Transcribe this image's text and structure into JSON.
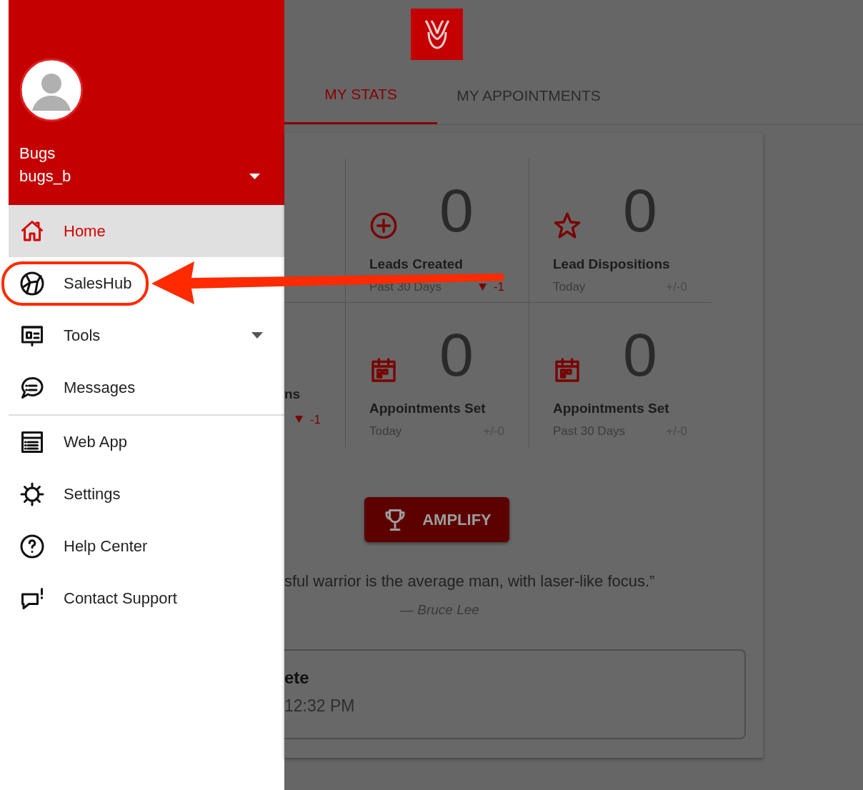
{
  "drawer": {
    "user": {
      "name": "Bugs",
      "username": "bugs_b"
    },
    "items": [
      {
        "label": "Home",
        "selected": true,
        "has_submenu": false
      },
      {
        "label": "SalesHub",
        "selected": false,
        "has_submenu": false
      },
      {
        "label": "Tools",
        "selected": false,
        "has_submenu": true
      },
      {
        "label": "Messages",
        "selected": false,
        "has_submenu": false
      }
    ],
    "secondary_items": [
      {
        "label": "Web App",
        "selected": false,
        "has_submenu": false
      },
      {
        "label": "Settings",
        "selected": false,
        "has_submenu": false
      },
      {
        "label": "Help Center",
        "selected": false,
        "has_submenu": false
      },
      {
        "label": "Contact Support",
        "selected": false,
        "has_submenu": false
      }
    ]
  },
  "tabs": [
    {
      "label": "MY STATS",
      "selected": true
    },
    {
      "label": "MY APPOINTMENTS",
      "selected": false
    }
  ],
  "stats": [
    {
      "kind": "empty"
    },
    {
      "kind": "full",
      "count": "0",
      "label": "Leads Created",
      "period": "Past 30 Days",
      "change": "-1",
      "decrease": true
    },
    {
      "kind": "full",
      "count": "0",
      "label": "Lead Dispositions",
      "period": "Today",
      "change": "+/-0",
      "decrease": false
    },
    {
      "kind": "partial",
      "label": "ns",
      "change": "-1",
      "decrease": true
    },
    {
      "kind": "full",
      "count": "0",
      "label": "Appointments Set",
      "period": "Today",
      "change": "+/-0",
      "decrease": false
    },
    {
      "kind": "full",
      "count": "0",
      "label": "Appointments Set",
      "period": "Past 30 Days",
      "change": "+/-0",
      "decrease": false
    }
  ],
  "amplify_button": "AMPLIFY",
  "quote": {
    "text": "sful warrior is the average man, with laser-like focus.”",
    "author": "— Bruce Lee"
  },
  "appointment_card": {
    "title": "ete",
    "time": "12:32 PM"
  }
}
